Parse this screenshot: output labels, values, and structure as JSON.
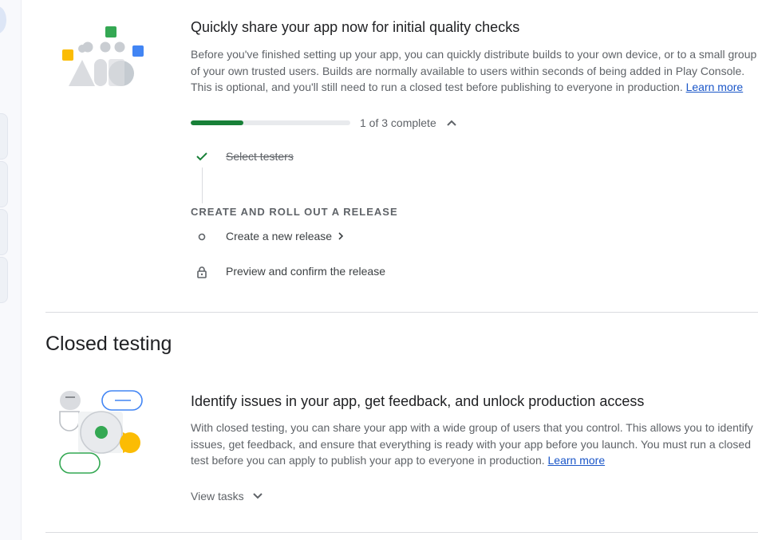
{
  "internal_testing_card": {
    "title": "Quickly share your app now for initial quality checks",
    "description_lines": [
      "Before you've finished setting up your app, you can quickly distribute builds to your own device, or to a small group",
      "of your own trusted users. Builds are normally available to users within seconds of being added in Play Console.",
      "This is optional, and you'll still need to run a closed test before publishing to everyone in production."
    ],
    "learn_more": "Learn more",
    "progress": {
      "fraction": 0.33,
      "text": "1 of 3 complete"
    },
    "tasks": {
      "completed": "Select testers",
      "group_heading": "CREATE AND ROLL OUT A RELEASE",
      "next": "Create a new release",
      "locked": "Preview and confirm the release"
    }
  },
  "closed_testing": {
    "section_title": "Closed testing",
    "card_title": "Identify issues in your app, get feedback, and unlock production access",
    "description_lines": [
      "With closed testing, you can share your app with a wide group of users that you control. This allows you to identify",
      "issues, get feedback, and ensure that everything is ready with your app before you launch. You must run a closed",
      "test before you can apply to publish your app to everyone in production."
    ],
    "learn_more": "Learn more",
    "view_tasks": "View tasks"
  },
  "colors": {
    "accent_green": "#188038",
    "link_blue": "#1a56c8",
    "illus_blue": "#4285f4",
    "illus_yellow": "#fbbc04",
    "illus_green": "#34a853"
  },
  "icons": [
    "check-icon",
    "chevron-up-icon",
    "circle-icon",
    "chevron-right-icon",
    "lock-icon",
    "chevron-down-icon"
  ]
}
